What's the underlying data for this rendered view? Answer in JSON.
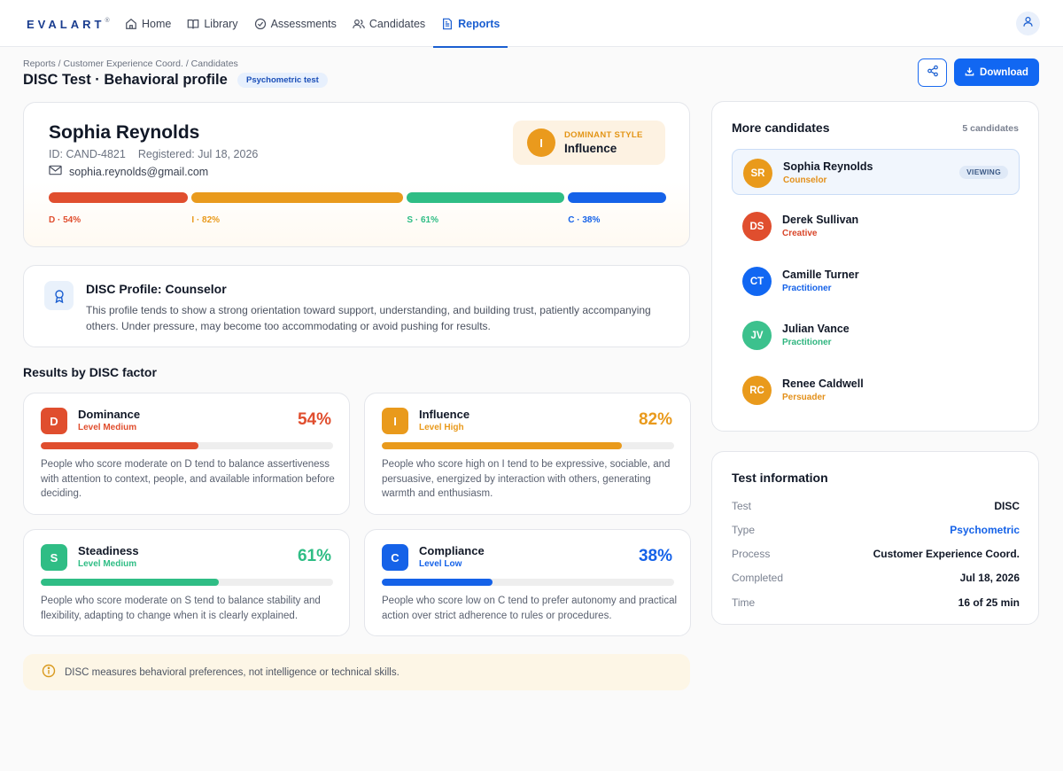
{
  "nav": {
    "logo": "EVALART",
    "logo_mark": "®",
    "items": [
      {
        "label": "Home",
        "icon": "home-icon"
      },
      {
        "label": "Library",
        "icon": "book-icon"
      },
      {
        "label": "Assessments",
        "icon": "check-circle-icon"
      },
      {
        "label": "Candidates",
        "icon": "users-icon"
      },
      {
        "label": "Reports",
        "icon": "document-icon",
        "active": true
      }
    ],
    "user_icon": "user-icon"
  },
  "header": {
    "breadcrumb": "Reports / Customer Experience Coord. / Candidates",
    "title": "DISC Test · Behavioral profile",
    "badge": "Psychometric test",
    "download_label": "Download"
  },
  "candidate": {
    "name": "Sophia Reynolds",
    "id": "ID: CAND-4821",
    "registered": "Registered: Jul 18, 2026",
    "email": "sophia.reynolds@gmail.com",
    "dominant_caption": "DOMINANT STYLE",
    "dominant_letter": "I",
    "dominant_value": "Influence",
    "bar_labels": {
      "d": "D · 54%",
      "i": "I · 82%",
      "s": "S · 61%",
      "c": "C · 38%"
    }
  },
  "profile": {
    "title": "DISC Profile: Counselor",
    "text": "This profile tends to show a strong orientation toward support, understanding, and building trust, patiently accompanying others. Under pressure, may become too accommodating or avoid pushing for results."
  },
  "results_title": "Results by DISC factor",
  "factors": [
    {
      "letter": "D",
      "name": "Dominance",
      "level": "Level Medium",
      "pct": "54%",
      "value": 54,
      "color": "#e04e2e",
      "desc": "People who score moderate on D tend to balance assertiveness with attention to context, people, and available information before deciding."
    },
    {
      "letter": "I",
      "name": "Influence",
      "level": "Level High",
      "pct": "82%",
      "value": 82,
      "color": "#e99a1c",
      "desc": "People who score high on I tend to be expressive, sociable, and persuasive, energized by interaction with others, generating warmth and enthusiasm."
    },
    {
      "letter": "S",
      "name": "Steadiness",
      "level": "Level Medium",
      "pct": "61%",
      "value": 61,
      "color": "#2fbd85",
      "desc": "People who score moderate on S tend to balance stability and flexibility, adapting to change when it is clearly explained."
    },
    {
      "letter": "C",
      "name": "Compliance",
      "level": "Level Low",
      "pct": "38%",
      "value": 38,
      "color": "#1562e8",
      "desc": "People who score low on C tend to prefer autonomy and practical action over strict adherence to rules or procedures."
    }
  ],
  "note": "DISC measures behavioral preferences, not intelligence or technical skills.",
  "more": {
    "title": "More candidates",
    "count": "5 candidates",
    "viewing_label": "VIEWING",
    "items": [
      {
        "initials": "SR",
        "name": "Sophia Reynolds",
        "role": "Counselor",
        "color": "#e99a1c",
        "role_color": "#e3901a"
      },
      {
        "initials": "DS",
        "name": "Derek Sullivan",
        "role": "Creative",
        "color": "#e04e2e",
        "role_color": "#d9462a"
      },
      {
        "initials": "CT",
        "name": "Camille Turner",
        "role": "Practitioner",
        "color": "#1167f2",
        "role_color": "#1562e8"
      },
      {
        "initials": "JV",
        "name": "Julian Vance",
        "role": "Practitioner",
        "color": "#3cc18d",
        "role_color": "#2fb57f"
      },
      {
        "initials": "RC",
        "name": "Renee Caldwell",
        "role": "Persuader",
        "color": "#e99a1c",
        "role_color": "#e3901a"
      }
    ]
  },
  "info": {
    "title": "Test information",
    "rows": [
      {
        "key": "Test",
        "value": "DISC"
      },
      {
        "key": "Type",
        "value": "Psychometric"
      },
      {
        "key": "Process",
        "value": "Customer Experience Coord."
      },
      {
        "key": "Completed",
        "value": "Jul 18, 2026"
      },
      {
        "key": "Time",
        "value": "16 of 25 min"
      }
    ]
  }
}
